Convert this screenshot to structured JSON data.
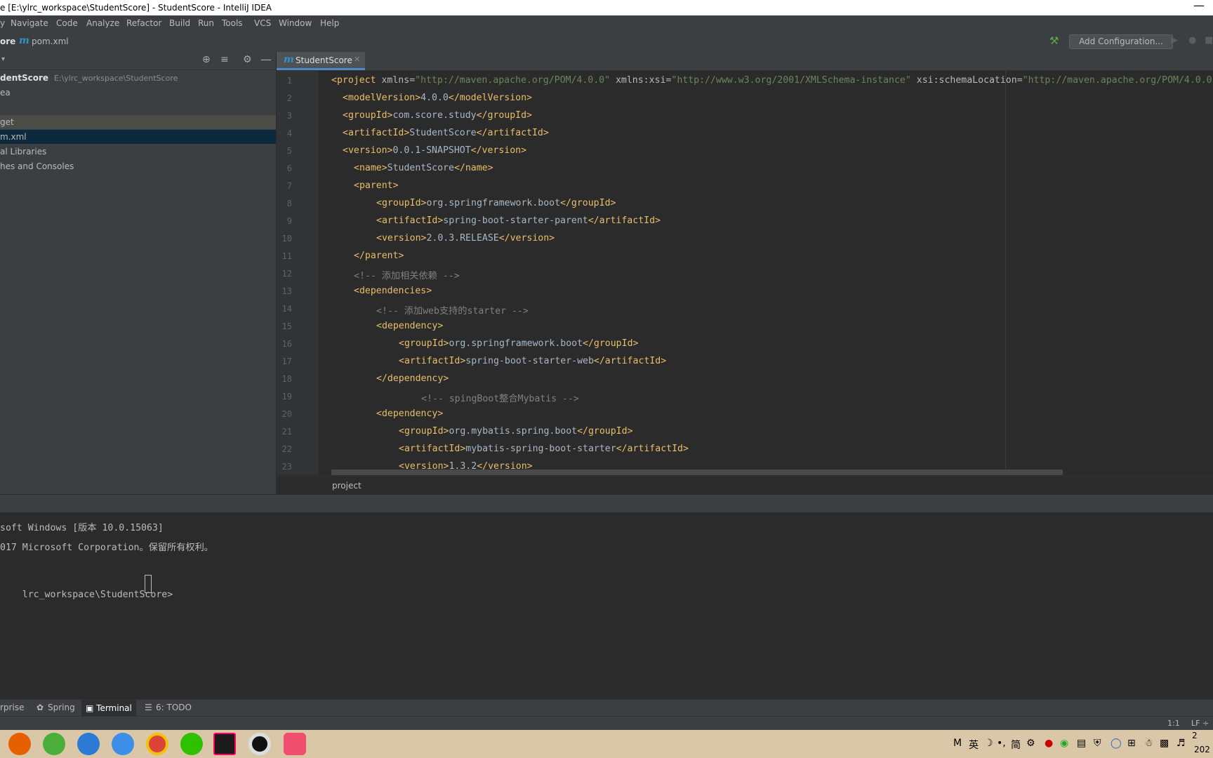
{
  "window": {
    "title": "e [E:\\ylrc_workspace\\StudentScore] - StudentScore - IntelliJ IDEA",
    "minimize_glyph": "—"
  },
  "menu": [
    "y",
    "Navigate",
    "Code",
    "Analyze",
    "Refactor",
    "Build",
    "Run",
    "Tools",
    "VCS",
    "Window",
    "Help"
  ],
  "nav": {
    "project_crumb": "ore",
    "file_crumb": "pom.xml",
    "maven_glyph": "m",
    "run_config": "Add Configuration..."
  },
  "project": {
    "tree": [
      {
        "name": "dentScore",
        "path": "E:\\ylrc_workspace\\StudentScore"
      },
      {
        "name": "ea"
      },
      {
        "name": "get"
      },
      {
        "name": "m.xml"
      },
      {
        "name": "al Libraries"
      },
      {
        "name": "hes and Consoles"
      }
    ]
  },
  "editor": {
    "tab": "StudentScore",
    "line_numbers": [
      "1",
      "2",
      "3",
      "4",
      "5",
      "6",
      "7",
      "8",
      "9",
      "10",
      "11",
      "12",
      "13",
      "14",
      "15",
      "16",
      "17",
      "18",
      "19",
      "20",
      "21",
      "22",
      "23"
    ],
    "lines": [
      "<project xmlns=\"http://maven.apache.org/POM/4.0.0\" xmlns:xsi=\"http://www.w3.org/2001/XMLSchema-instance\" xsi:schemaLocation=\"http://maven.apache.org/POM/4.0.0",
      "<modelVersion>4.0.0</modelVersion>",
      "<groupId>com.score.study</groupId>",
      "<artifactId>StudentScore</artifactId>",
      "<version>0.0.1-SNAPSHOT</version>",
      "<name>StudentScore</name>",
      "<parent>",
      "<groupId>org.springframework.boot</groupId>",
      "<artifactId>spring-boot-starter-parent</artifactId>",
      "<version>2.0.3.RELEASE</version>",
      "</parent>",
      "<!-- 添加相关依赖 -->",
      "<dependencies>",
      "<!-- 添加web支持的starter -->",
      "<dependency>",
      "<groupId>org.springframework.boot</groupId>",
      "<artifactId>spring-boot-starter-web</artifactId>",
      "</dependency>",
      "<!-- spingBoot整合Mybatis -->",
      "<dependency>",
      "<groupId>org.mybatis.spring.boot</groupId>",
      "<artifactId>mybatis-spring-boot-starter</artifactId>",
      "<version>1.3.2</version>"
    ],
    "breadcrumb": "project"
  },
  "terminal": {
    "lines": [
      "soft Windows [版本 10.0.15063]",
      "017 Microsoft Corporation。保留所有权利。",
      "",
      "lrc_workspace\\StudentScore>"
    ]
  },
  "tool_tabs": [
    "rprise",
    "Spring",
    "Terminal",
    "6: TODO"
  ],
  "status": {
    "position": "1:1",
    "line_sep": "LF ÷"
  },
  "tray": {
    "ime_mode": "M",
    "ime_lang": "英",
    "ime_char": "简",
    "clock_a": "2",
    "clock_b": "202"
  },
  "colors": {
    "accent": "#4a88c7",
    "tag": "#e8bf6a",
    "string": "#6a8759",
    "comment": "#808080"
  }
}
